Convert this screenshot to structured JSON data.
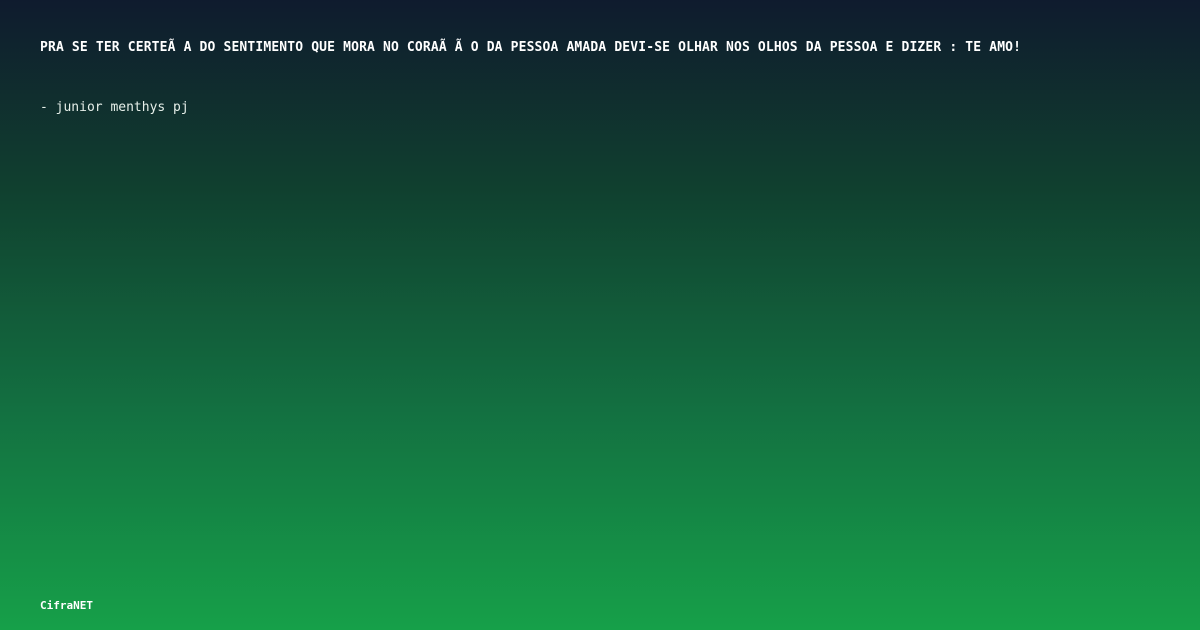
{
  "quote": {
    "text": "PRA SE TER CERTEÃ A DO SENTIMENTO QUE MORA NO CORAÃ Ã O DA PESSOA AMADA DEVI-SE OLHAR NOS OLHOS DA PESSOA E DIZER : TE AMO!",
    "author": "- junior menthys pj"
  },
  "brand": {
    "name": "CifraNET"
  },
  "colors": {
    "background_top": "#0f1b2e",
    "background_bottom": "#16a049",
    "text": "#ffffff"
  }
}
